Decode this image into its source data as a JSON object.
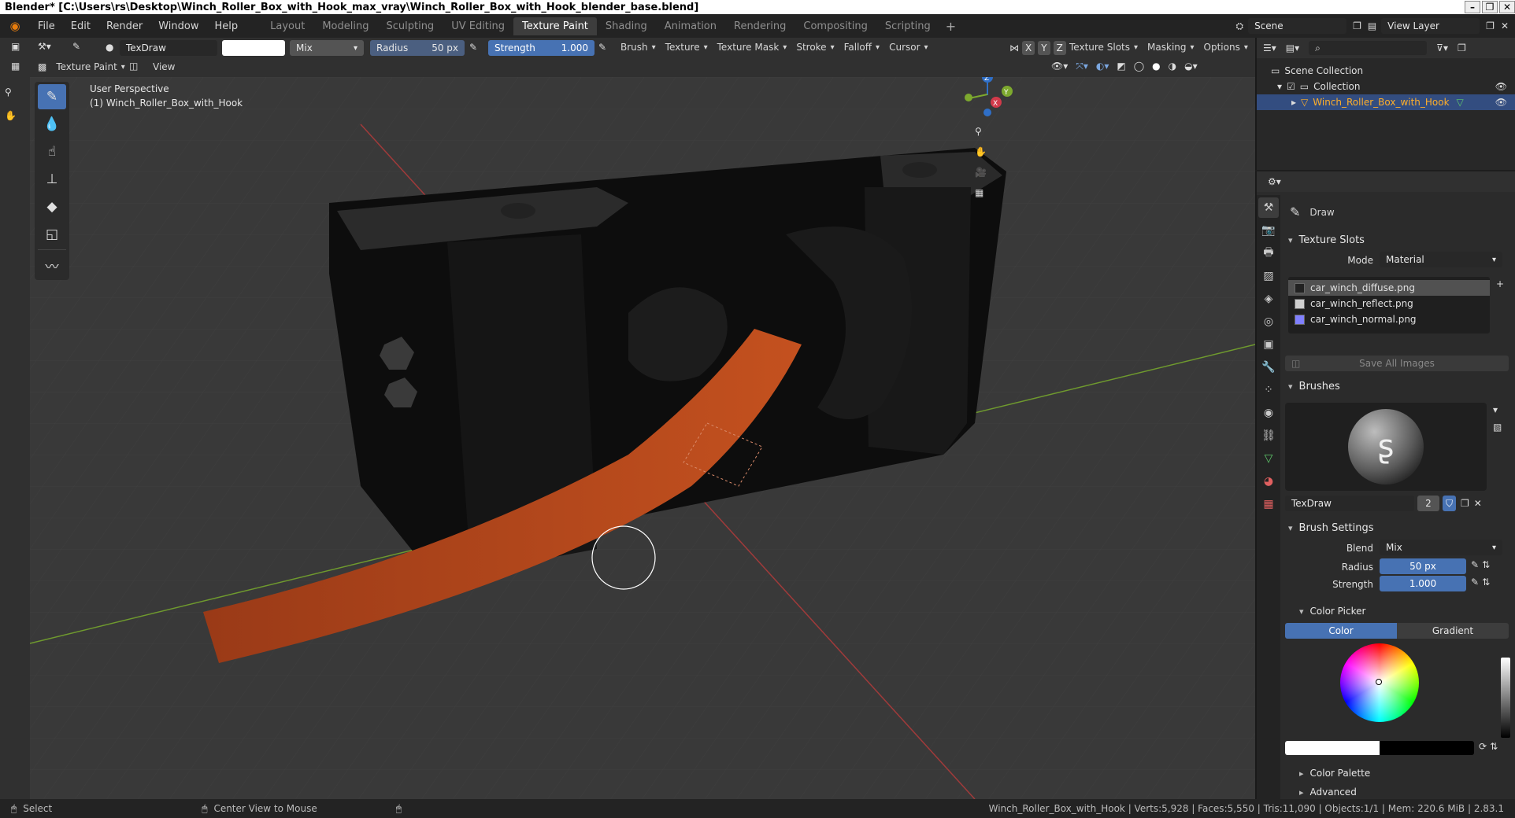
{
  "window": {
    "title": "Blender* [C:\\Users\\rs\\Desktop\\Winch_Roller_Box_with_Hook_max_vray\\Winch_Roller_Box_with_Hook_blender_base.blend]"
  },
  "menu": {
    "items": [
      "File",
      "Edit",
      "Render",
      "Window",
      "Help"
    ]
  },
  "workspaces": {
    "tabs": [
      "Layout",
      "Modeling",
      "Sculpting",
      "UV Editing",
      "Texture Paint",
      "Shading",
      "Animation",
      "Rendering",
      "Compositing",
      "Scripting"
    ],
    "active": "Texture Paint"
  },
  "scene": {
    "name": "Scene",
    "view_layer": "View Layer"
  },
  "tool_header": {
    "brush_name": "TexDraw",
    "blend": "Mix",
    "radius_label": "Radius",
    "radius_value": "50 px",
    "strength_label": "Strength",
    "strength_value": "1.000",
    "menus": [
      "Brush",
      "Texture",
      "Texture Mask",
      "Stroke",
      "Falloff",
      "Cursor"
    ],
    "axes": [
      "X",
      "Y",
      "Z"
    ],
    "right_menus": [
      "Texture Slots",
      "Masking",
      "Options"
    ]
  },
  "view_header": {
    "mode": "Texture Paint",
    "view_menu": "View"
  },
  "viewport": {
    "perspective": "User Perspective",
    "object_label": "(1) Winch_Roller_Box_with_Hook",
    "gizmo": {
      "x": "X",
      "y": "Y",
      "z": "Z"
    }
  },
  "outliner": {
    "root": "Scene Collection",
    "collection": "Collection",
    "object": "Winch_Roller_Box_with_Hook"
  },
  "properties": {
    "tool_name": "Draw",
    "texture_slots": {
      "title": "Texture Slots",
      "mode_label": "Mode",
      "mode_value": "Material",
      "slots": [
        {
          "name": "car_winch_diffuse.png",
          "color": "#222222"
        },
        {
          "name": "car_winch_reflect.png",
          "color": "#cfcfcf"
        },
        {
          "name": "car_winch_normal.png",
          "color": "#8080ff"
        }
      ],
      "save_all": "Save All Images"
    },
    "brushes": {
      "title": "Brushes",
      "brush_name": "TexDraw",
      "users": "2"
    },
    "brush_settings": {
      "title": "Brush Settings",
      "blend_label": "Blend",
      "blend_value": "Mix",
      "radius_label": "Radius",
      "radius_value": "50 px",
      "strength_label": "Strength",
      "strength_value": "1.000"
    },
    "color_picker": {
      "title": "Color Picker",
      "tab_color": "Color",
      "tab_gradient": "Gradient"
    },
    "color_palette": "Color Palette",
    "advanced": "Advanced"
  },
  "status": {
    "select": "Select",
    "center_view": "Center View to Mouse",
    "stats": "Winch_Roller_Box_with_Hook | Verts:5,928 | Faces:5,550 | Tris:11,090 | Objects:1/1 | Mem: 220.6 MiB | 2.83.1"
  },
  "colors": {
    "accent": "#4772b3",
    "strap": "#b4481f",
    "selection_text": "#ffaf29"
  }
}
